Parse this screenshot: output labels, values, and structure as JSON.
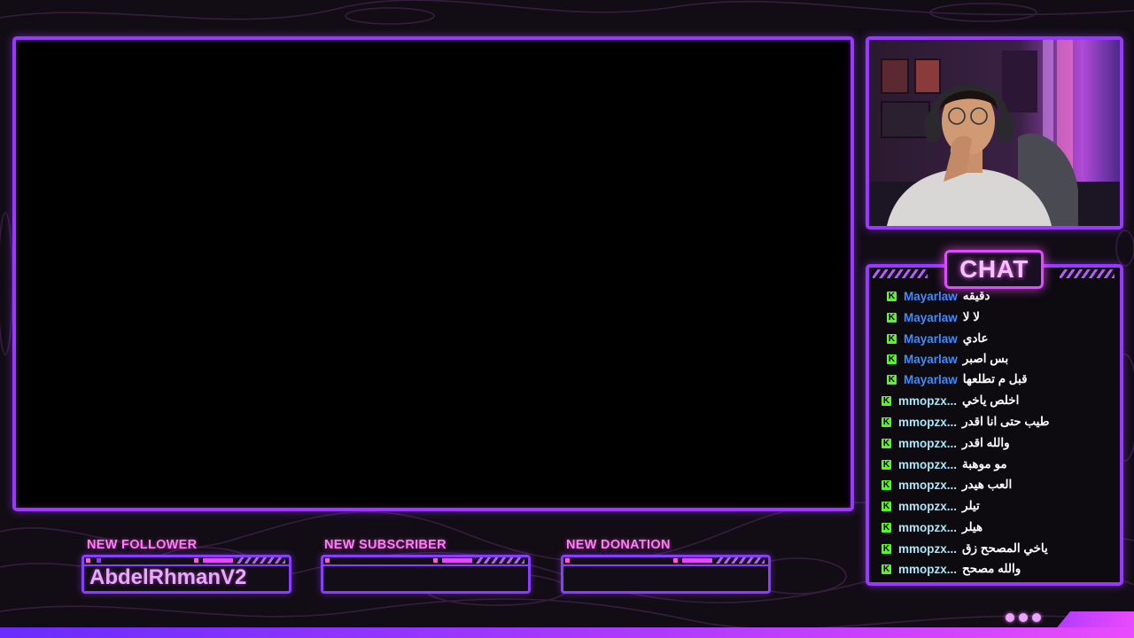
{
  "chat": {
    "title": "CHAT",
    "messages": [
      {
        "user": "Mayarlaw",
        "text": "دقيقه",
        "user_color": "#3f8cff"
      },
      {
        "user": "Mayarlaw",
        "text": "لا لا",
        "user_color": "#3f8cff"
      },
      {
        "user": "Mayarlaw",
        "text": "عادي",
        "user_color": "#3f8cff"
      },
      {
        "user": "Mayarlaw",
        "text": "بس اصبر",
        "user_color": "#3f8cff"
      },
      {
        "user": "Mayarlaw",
        "text": "قبل م تطلعها",
        "user_color": "#3f8cff"
      },
      {
        "user": "mmopzx...",
        "text": "اخلص ياخي",
        "user_color": "#a8e6f8"
      },
      {
        "user": "mmopzx...",
        "text": "طيب حتى انا اقدر",
        "user_color": "#a8e6f8"
      },
      {
        "user": "mmopzx...",
        "text": "والله اقدر",
        "user_color": "#a8e6f8"
      },
      {
        "user": "mmopzx...",
        "text": "مو موهبة",
        "user_color": "#a8e6f8"
      },
      {
        "user": "mmopzx...",
        "text": "العب هيدر",
        "user_color": "#a8e6f8"
      },
      {
        "user": "mmopzx...",
        "text": "تيلر",
        "user_color": "#a8e6f8"
      },
      {
        "user": "mmopzx...",
        "text": "هيلر",
        "user_color": "#a8e6f8"
      },
      {
        "user": "mmopzx...",
        "text": "ياخي المصحح زق",
        "user_color": "#a8e6f8"
      },
      {
        "user": "mmopzx...",
        "text": "والله مصحح",
        "user_color": "#a8e6f8"
      }
    ]
  },
  "alerts": {
    "follower": {
      "label": "NEW FOLLOWER",
      "value": "AbdelRhmanV2"
    },
    "subscriber": {
      "label": "NEW SUBSCRIBER",
      "value": ""
    },
    "donation": {
      "label": "NEW DONATION",
      "value": ""
    }
  },
  "colors": {
    "frame_border": "#9b38ff",
    "accent_pink": "#e14bff",
    "kick_green": "#53fc18",
    "background": "#120d14"
  },
  "icons": {
    "kick_badge": "kick-icon"
  }
}
